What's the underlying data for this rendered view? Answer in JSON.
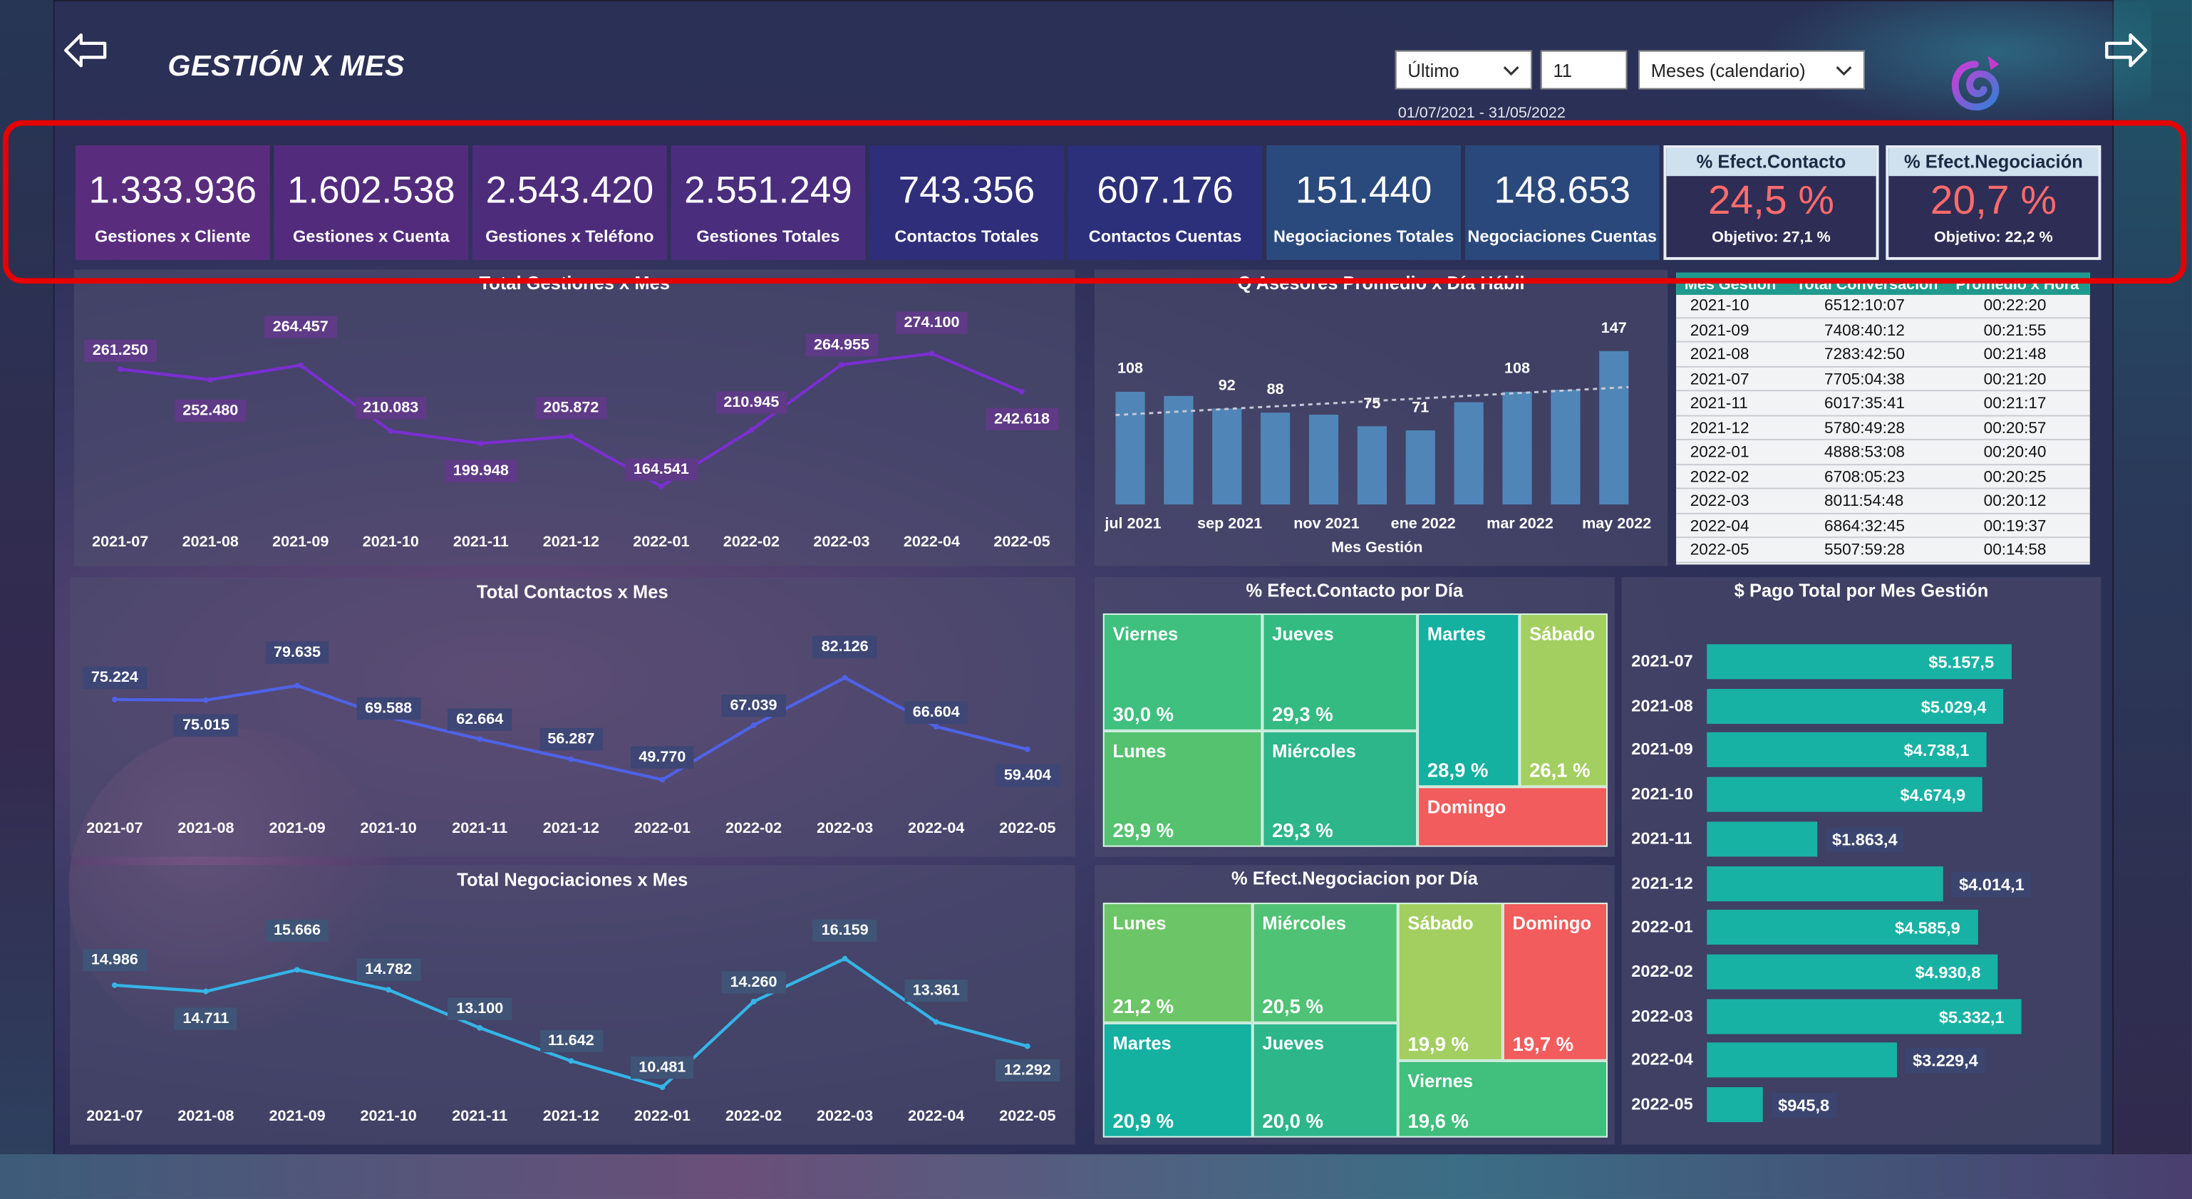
{
  "header": {
    "title": "GESTIÓN X MES",
    "back_icon": "arrow-left-icon",
    "next_icon": "arrow-right-icon",
    "logo_icon": "app-logo-icon",
    "slicer_period": "Último",
    "slicer_count": "11",
    "slicer_unit": "Meses (calendario)",
    "date_range": "01/07/2021 - 31/05/2022"
  },
  "kpis": [
    {
      "value": "1.333.936",
      "label": "Gestiones x Cliente",
      "color": "#5a2c7e"
    },
    {
      "value": "1.602.538",
      "label": "Gestiones x Cuenta",
      "color": "#532b7c"
    },
    {
      "value": "2.543.420",
      "label": "Gestiones x Teléfono",
      "color": "#4e2c7c"
    },
    {
      "value": "2.551.249",
      "label": "Gestiones Totales",
      "color": "#4a2d7d"
    },
    {
      "value": "743.356",
      "label": "Contactos Totales",
      "color": "#2f2e7a"
    },
    {
      "value": "607.176",
      "label": "Contactos Cuentas",
      "color": "#2c2f79"
    },
    {
      "value": "151.440",
      "label": "Negociaciones Totales",
      "color": "#2a4a7d"
    },
    {
      "value": "148.653",
      "label": "Negociaciones Cuentas",
      "color": "#2a487b"
    }
  ],
  "efect_contacto": {
    "header": "% Efect.Contacto",
    "value": "24,5 %",
    "objective": "Objetivo: 27,1 %"
  },
  "efect_negociacion": {
    "header": "% Efect.Negociación",
    "value": "20,7 %",
    "objective": "Objetivo: 22,2 %"
  },
  "chart_data": [
    {
      "type": "line",
      "title": "Total Gestiones x Mes",
      "categories": [
        "2021-07",
        "2021-08",
        "2021-09",
        "2021-10",
        "2021-11",
        "2021-12",
        "2022-01",
        "2022-02",
        "2022-03",
        "2022-04",
        "2022-05"
      ],
      "values": [
        261250,
        252480,
        264457,
        210083,
        199948,
        205872,
        164541,
        210945,
        264955,
        274100,
        242618
      ],
      "labels": [
        "261.250",
        "252.480",
        "264.457",
        "210.083",
        "199.948",
        "205.872",
        "164.541",
        "210.945",
        "264.955",
        "274.100",
        "242.618"
      ],
      "color": "#7a2fd0"
    },
    {
      "type": "bar",
      "title": "Q Asesores Promedio x Día Hábil",
      "xlabel": "Mes Gestión",
      "tick_labels": [
        "jul 2021",
        "sep 2021",
        "nov 2021",
        "ene 2022",
        "mar 2022",
        "may 2022"
      ],
      "values": [
        108,
        104,
        92,
        88,
        86,
        75,
        71,
        98,
        108,
        110,
        147
      ],
      "value_labels": [
        "108",
        "",
        "92",
        "88",
        "",
        "75",
        "71",
        "",
        "108",
        "",
        "147"
      ],
      "trend": "dotted",
      "color": "#4f86b7"
    },
    {
      "type": "line",
      "title": "Total Contactos x Mes",
      "categories": [
        "2021-07",
        "2021-08",
        "2021-09",
        "2021-10",
        "2021-11",
        "2021-12",
        "2022-01",
        "2022-02",
        "2022-03",
        "2022-04",
        "2022-05"
      ],
      "values": [
        75224,
        75015,
        79635,
        69588,
        62664,
        56287,
        49770,
        67039,
        82126,
        66604,
        59404
      ],
      "labels": [
        "75.224",
        "75.015",
        "79.635",
        "69.588",
        "62.664",
        "56.287",
        "49.770",
        "67.039",
        "82.126",
        "66.604",
        "59.404"
      ],
      "color": "#4f62e6"
    },
    {
      "type": "line",
      "title": "Total Negociaciones x Mes",
      "categories": [
        "2021-07",
        "2021-08",
        "2021-09",
        "2021-10",
        "2021-11",
        "2021-12",
        "2022-01",
        "2022-02",
        "2022-03",
        "2022-04",
        "2022-05"
      ],
      "values": [
        14986,
        14711,
        15666,
        14782,
        13100,
        11642,
        10481,
        14260,
        16159,
        13361,
        12292
      ],
      "labels": [
        "14.986",
        "14.711",
        "15.666",
        "14.782",
        "13.100",
        "11.642",
        "10.481",
        "14.260",
        "16.159",
        "13.361",
        "12.292"
      ],
      "color": "#35b4e6"
    },
    {
      "type": "bar",
      "orientation": "horizontal",
      "title": "$ Pago Total por Mes Gestión",
      "categories": [
        "2021-07",
        "2021-08",
        "2021-09",
        "2021-10",
        "2021-11",
        "2021-12",
        "2022-01",
        "2022-02",
        "2022-03",
        "2022-04",
        "2022-05"
      ],
      "values": [
        5157.5,
        5029.4,
        4738.1,
        4674.9,
        1863.4,
        4014.1,
        4585.9,
        4930.8,
        5332.1,
        3229.4,
        945.8
      ],
      "labels": [
        "$5.157,5",
        "$5.029,4",
        "$4.738,1",
        "$4.674,9",
        "$1.863,4",
        "$4.014,1",
        "$4.585,9",
        "$4.930,8",
        "$5.332,1",
        "$3.229,4",
        "$945,8"
      ],
      "color": "#18b2a5"
    }
  ],
  "table": {
    "headers": [
      "Mes Gestión",
      "Total Conversación",
      "Promedio x Hora"
    ],
    "rows": [
      [
        "2021-10",
        "6512:10:07",
        "00:22:20"
      ],
      [
        "2021-09",
        "7408:40:12",
        "00:21:55"
      ],
      [
        "2021-08",
        "7283:42:50",
        "00:21:48"
      ],
      [
        "2021-07",
        "7705:04:38",
        "00:21:20"
      ],
      [
        "2021-11",
        "6017:35:41",
        "00:21:17"
      ],
      [
        "2021-12",
        "5780:49:28",
        "00:20:57"
      ],
      [
        "2022-01",
        "4888:53:08",
        "00:20:40"
      ],
      [
        "2022-02",
        "6708:05:23",
        "00:20:25"
      ],
      [
        "2022-03",
        "8011:54:48",
        "00:20:12"
      ],
      [
        "2022-04",
        "6864:32:45",
        "00:19:37"
      ],
      [
        "2022-05",
        "5507:59:28",
        "00:14:58"
      ]
    ]
  },
  "treemap_contacto": {
    "title": "% Efect.Contacto por Día",
    "cells": [
      {
        "name": "Viernes",
        "value": "30,0 %",
        "color": "#3fc07e"
      },
      {
        "name": "Jueves",
        "value": "29,3 %",
        "color": "#33bb82"
      },
      {
        "name": "Lunes",
        "value": "29,9 %",
        "color": "#55c270"
      },
      {
        "name": "Miércoles",
        "value": "29,3 %",
        "color": "#2cb68a"
      },
      {
        "name": "Martes",
        "value": "28,9 %",
        "color": "#14b0a0"
      },
      {
        "name": "Sábado",
        "value": "26,1 %",
        "color": "#a3cf60"
      },
      {
        "name": "Domingo",
        "value": "",
        "color": "#f25c5c"
      }
    ]
  },
  "treemap_negociacion": {
    "title": "% Efect.Negociacion por Día",
    "cells": [
      {
        "name": "Lunes",
        "value": "21,2 %",
        "color": "#6cc566"
      },
      {
        "name": "Miércoles",
        "value": "20,5 %",
        "color": "#50c275"
      },
      {
        "name": "Sábado",
        "value": "19,9 %",
        "color": "#a3cf60"
      },
      {
        "name": "Domingo",
        "value": "19,7 %",
        "color": "#f25c5c"
      },
      {
        "name": "Martes",
        "value": "20,9 %",
        "color": "#14b0a0"
      },
      {
        "name": "Jueves",
        "value": "20,0 %",
        "color": "#2cb68a"
      },
      {
        "name": "Viernes",
        "value": "19,6 %",
        "color": "#41bf7c"
      }
    ]
  }
}
